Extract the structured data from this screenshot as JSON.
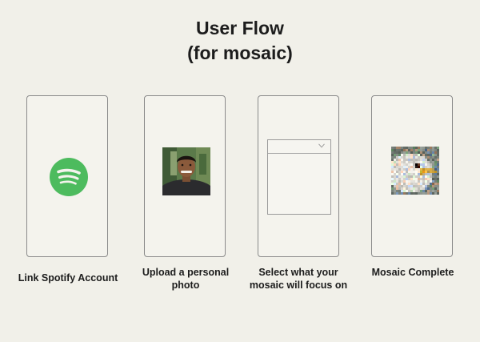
{
  "title": {
    "line1": "User Flow",
    "line2": "(for mosaic)"
  },
  "steps": [
    {
      "caption": "Link Spotify Account",
      "icon": "spotify-logo-icon"
    },
    {
      "caption": "Upload a personal photo",
      "icon": "personal-photo"
    },
    {
      "caption": "Select what your mosaic will focus on",
      "icon": "dropdown-select"
    },
    {
      "caption": "Mosaic Complete",
      "icon": "mosaic-image"
    }
  ],
  "colors": {
    "background": "#f1f0e9",
    "spotify_green": "#4dbb5e",
    "frame_border": "#8a8a8a"
  }
}
